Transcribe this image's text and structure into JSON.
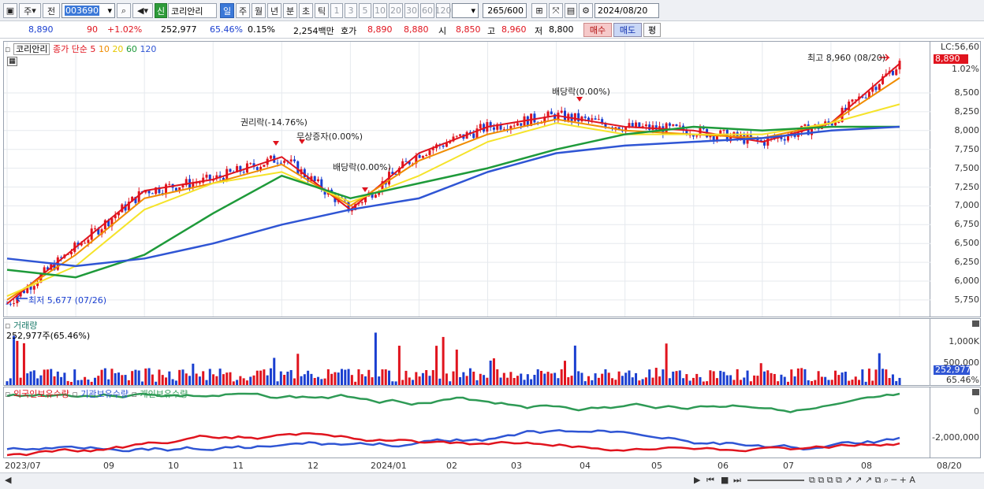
{
  "toolbar": {
    "period_day": "주",
    "prev_label": "전",
    "stock_code": "003690",
    "new_badge": "신",
    "stock_name": "코리안리",
    "tabs": [
      "일",
      "주",
      "월",
      "년",
      "분",
      "초",
      "틱"
    ],
    "minute_options": [
      "1",
      "3",
      "5",
      "10",
      "20",
      "30",
      "60",
      "120"
    ],
    "count": "265",
    "count_total": "/600",
    "date": "2024/08/20"
  },
  "info": {
    "price": "8,890",
    "change": "90",
    "change_pct": "+1.02%",
    "volume": "252,977",
    "vol_ratio": "65.46%",
    "turnover": "0.15%",
    "amount": "2,254백만",
    "bid_label": "호가",
    "bid1": "8,890",
    "bid2": "8,880",
    "open_label": "시",
    "open": "8,850",
    "high_label": "고",
    "high": "8,960",
    "low_label": "저",
    "low": "8,800",
    "buy": "매수",
    "sell": "매도",
    "eval": "평"
  },
  "price_panel": {
    "legend_name": "코리안리",
    "legend_ma_label": "종가 단순 5",
    "legend_ma": [
      "10",
      "20",
      "60",
      "120"
    ],
    "lc_label": "LC:56,60",
    "current_price": "8,890",
    "current_pct": "1.02%",
    "high_marker": "최고 8,960 (08/20)",
    "low_marker": "최저 5,677 (07/26)",
    "annotations": [
      "권리락(-14.76%)",
      "무상증자(0.00%)",
      "배당락(0.00%)",
      "배당락(0.00%)"
    ],
    "y_ticks": [
      "8,500",
      "8,250",
      "8,000",
      "7,750",
      "7,500",
      "7,250",
      "7,000",
      "6,750",
      "6,500",
      "6,250",
      "6,000",
      "5,750"
    ]
  },
  "volume_panel": {
    "title": "거래량",
    "value_text": "252,977주(65.46%)",
    "y_ticks": [
      "1,000K",
      "500,000"
    ],
    "current_volume": "252,977",
    "current_pct": "65.46%"
  },
  "holdings_panel": {
    "legend": [
      "외국인보유수량",
      "기관보유수량",
      "개인보유수량"
    ],
    "y_ticks": [
      "0",
      "-2,000,000"
    ]
  },
  "x_axis": [
    "2023/07",
    "09",
    "10",
    "11",
    "12",
    "2024/01",
    "02",
    "03",
    "04",
    "05",
    "06",
    "07",
    "08",
    "08/20"
  ],
  "colors": {
    "up": "#e0141e",
    "down": "#1a3fd0",
    "ma5": "#e0141e",
    "ma10": "#f08c00",
    "ma20": "#f5e32a",
    "ma60": "#1e9a3a",
    "ma120": "#2f55d4",
    "foreign": "#e0141e",
    "institution": "#2f55d4",
    "individual": "#2e9a55"
  },
  "chart_data": {
    "type": "line",
    "ylim": [
      5550,
      8950
    ],
    "x": [
      "2023/07",
      "09",
      "10",
      "11",
      "12",
      "2024/01",
      "02",
      "03",
      "04",
      "05",
      "06",
      "07",
      "08",
      "08/20"
    ],
    "series": [
      {
        "name": "5",
        "values": [
          5700,
          6450,
          7200,
          7350,
          7650,
          6950,
          7700,
          8050,
          8200,
          8050,
          8000,
          7850,
          8100,
          8890
        ]
      },
      {
        "name": "10",
        "values": [
          5750,
          6350,
          7100,
          7300,
          7550,
          7000,
          7600,
          7950,
          8150,
          8000,
          7950,
          7900,
          8100,
          8700
        ]
      },
      {
        "name": "20",
        "values": [
          5800,
          6200,
          6950,
          7300,
          7450,
          7050,
          7400,
          7850,
          8100,
          7950,
          7950,
          7950,
          8100,
          8350
        ]
      },
      {
        "name": "60",
        "values": [
          6150,
          6050,
          6350,
          6900,
          7400,
          7100,
          7300,
          7500,
          7750,
          7950,
          8050,
          8000,
          8050,
          8050
        ]
      },
      {
        "name": "120",
        "values": [
          6300,
          6200,
          6300,
          6500,
          6750,
          6950,
          7100,
          7450,
          7700,
          7800,
          7850,
          7900,
          8000,
          8050
        ]
      }
    ]
  }
}
